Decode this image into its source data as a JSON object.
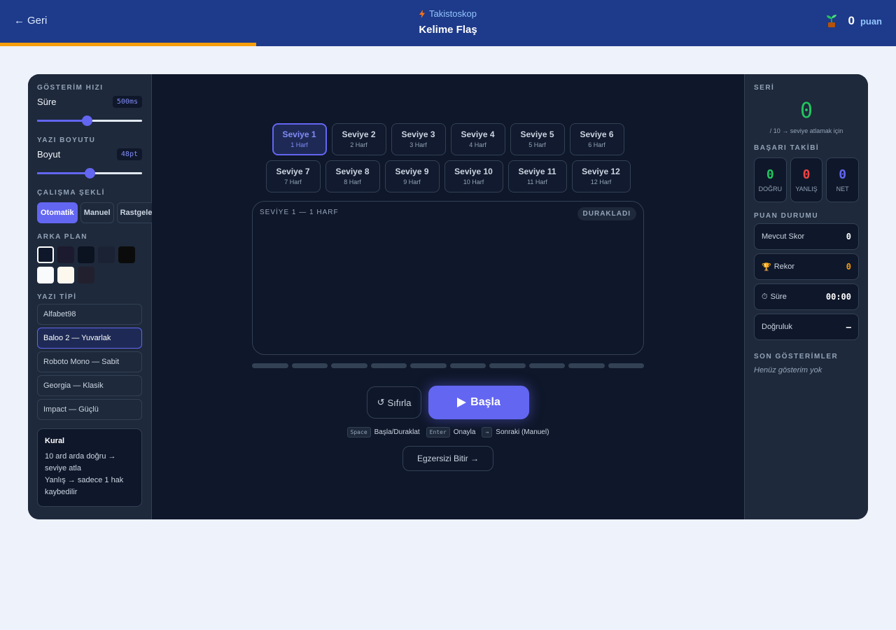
{
  "header": {
    "back_label": "Geri",
    "subtitle": "Takistoskop",
    "title": "Kelime Flaş",
    "score_value": "0",
    "score_label": "puan",
    "progress_fraction": 0.286
  },
  "left": {
    "speed": {
      "title": "GÖSTERİM HIZI",
      "label": "Süre",
      "value": "500ms",
      "fraction": 0.47
    },
    "size": {
      "title": "YAZI BOYUTU",
      "label": "Boyut",
      "value": "48pt",
      "fraction": 0.5
    },
    "mode": {
      "title": "ÇALIŞMA ŞEKLİ",
      "options": [
        "Otomatik",
        "Manuel",
        "Rastgele"
      ],
      "selected": 0
    },
    "background": {
      "title": "ARKA PLAN",
      "colors": [
        "#0f172a",
        "#1c1a2e",
        "#0b1220",
        "#1a2233",
        "#0b0b0b",
        "#f8fafc",
        "#fdf8ee",
        "#22202e"
      ],
      "selected": 0
    },
    "font": {
      "title": "YAZI TİPİ",
      "options": [
        "Alfabet98",
        "Baloo 2 — Yuvarlak",
        "Roboto Mono — Sabit",
        "Georgia — Klasik",
        "Impact — Güçlü"
      ],
      "selected": 1
    },
    "rule": {
      "title": "Kural",
      "line1": "10 ard arda doğru → seviye atla",
      "line2": "Yanlış → sadece 1 hak kaybedilir"
    }
  },
  "levels": [
    {
      "name": "Seviye 1",
      "sub": "1 Harf"
    },
    {
      "name": "Seviye 2",
      "sub": "2 Harf"
    },
    {
      "name": "Seviye 3",
      "sub": "3 Harf"
    },
    {
      "name": "Seviye 4",
      "sub": "4 Harf"
    },
    {
      "name": "Seviye 5",
      "sub": "5 Harf"
    },
    {
      "name": "Seviye 6",
      "sub": "6 Harf"
    },
    {
      "name": "Seviye 7",
      "sub": "7 Harf"
    },
    {
      "name": "Seviye 8",
      "sub": "8 Harf"
    },
    {
      "name": "Seviye 9",
      "sub": "9 Harf"
    },
    {
      "name": "Seviye 10",
      "sub": "10 Harf"
    },
    {
      "name": "Seviye 11",
      "sub": "11 Harf"
    },
    {
      "name": "Seviye 12",
      "sub": "12 Harf"
    }
  ],
  "active_level": 0,
  "display": {
    "caption": "SEVİYE 1 — 1 HARF",
    "status": "DURAKLADI"
  },
  "progress_dots": 10,
  "actions": {
    "reset_label": "Sıfırla",
    "start_label": "Başla",
    "finish_label": "Egzersizi Bitir →"
  },
  "hints": [
    {
      "key": "Space",
      "text": "Başla/Duraklat"
    },
    {
      "key": "Enter",
      "text": "Onayla"
    },
    {
      "key": "→",
      "text": "Sonraki (Manuel)"
    }
  ],
  "right": {
    "streak": {
      "title": "SERİ",
      "value": "0",
      "note": "/ 10 → seviye atlamak için"
    },
    "tracking": {
      "title": "BAŞARI TAKİBİ",
      "correct": {
        "value": "0",
        "label": "DOĞRU",
        "color": "#22c55e"
      },
      "wrong": {
        "value": "0",
        "label": "YANLIŞ",
        "color": "#ef4444"
      },
      "net": {
        "value": "0",
        "label": "NET",
        "color": "#6366f1"
      }
    },
    "scores": {
      "title": "PUAN DURUMU",
      "current": {
        "label": "Mevcut Skor",
        "value": "0"
      },
      "record": {
        "label": "Rekor",
        "value": "0"
      },
      "time": {
        "label": "Süre",
        "value": "00:00"
      },
      "accuracy": {
        "label": "Doğruluk",
        "value": "–"
      }
    },
    "recent": {
      "title": "SON GÖSTERİMLER",
      "empty": "Henüz gösterim yok"
    }
  }
}
